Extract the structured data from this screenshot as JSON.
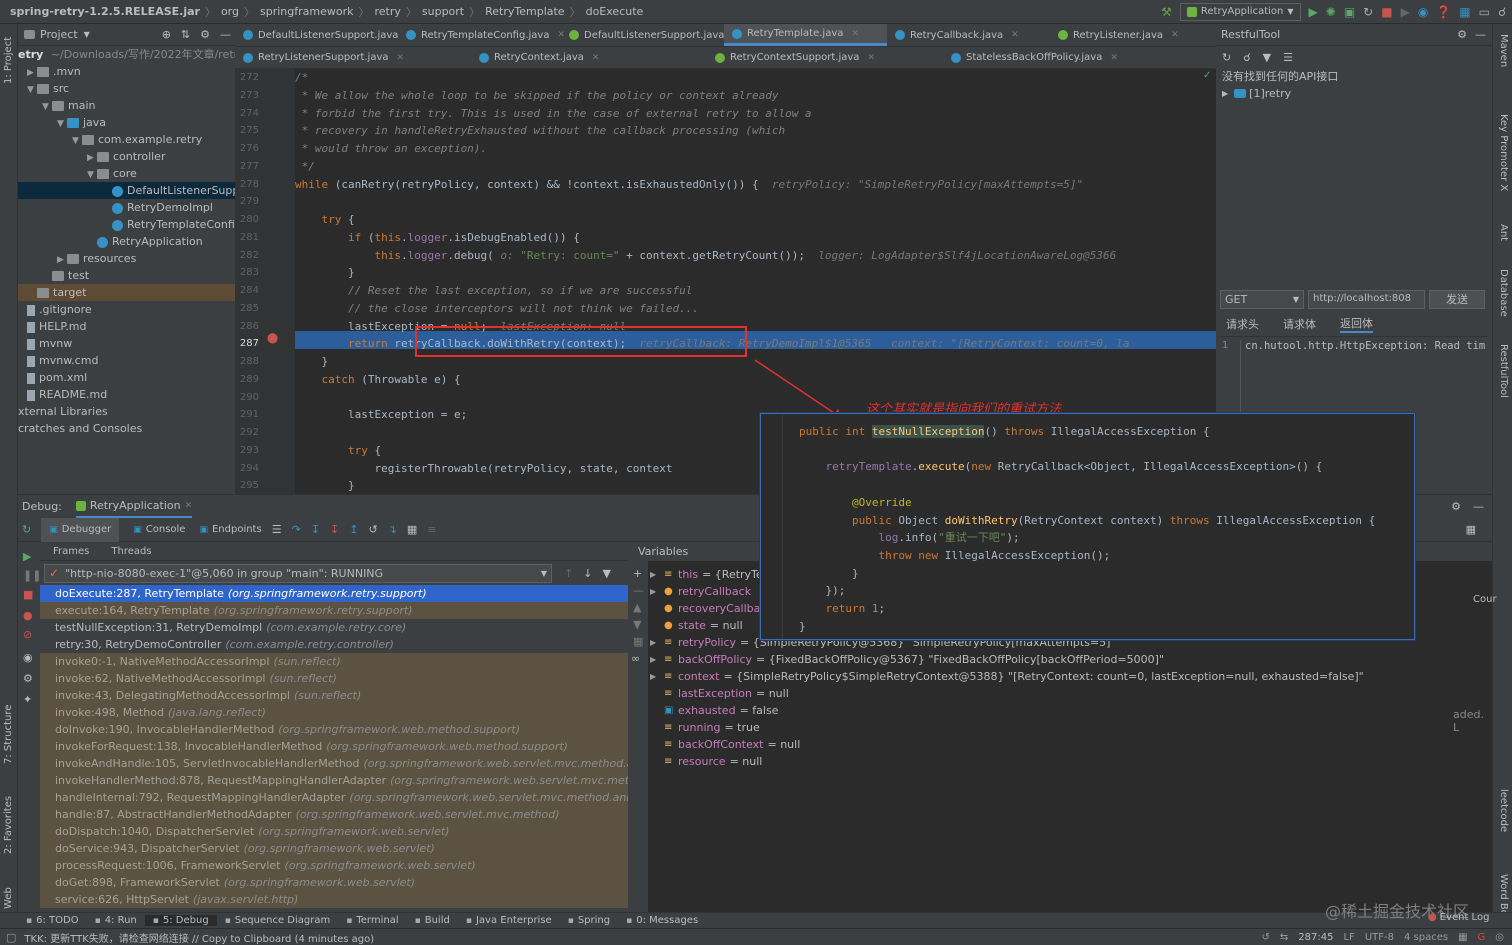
{
  "navbar": {
    "crumbs": [
      "spring-retry-1.2.5.RELEASE.jar",
      "org",
      "springframework",
      "retry",
      "support",
      "RetryTemplate",
      "doExecute"
    ],
    "run_config": "RetryApplication"
  },
  "editor_tabs_row1": [
    "DefaultListenerSupport.java",
    "RetryTemplateConfig.java",
    "DefaultListenerSupport.java",
    "RetryTemplate.java",
    "RetryCallback.java",
    "RetryListener.java"
  ],
  "editor_tabs_row2": [
    "RetryListenerSupport.java",
    "RetryContext.java",
    "RetryContextSupport.java",
    "StatelessBackOffPolicy.java"
  ],
  "active_tab": "RetryTemplate.java",
  "project": {
    "header": "Project",
    "root": "etry",
    "root_path": "~/Downloads/写作/2022年文章/retry",
    "items": [
      {
        "label": ".mvn",
        "kind": "folder",
        "indent": 1,
        "open": false
      },
      {
        "label": "src",
        "kind": "folder",
        "indent": 1,
        "open": true
      },
      {
        "label": "main",
        "kind": "folder",
        "indent": 2,
        "open": true
      },
      {
        "label": "java",
        "kind": "folder",
        "indent": 3,
        "open": true
      },
      {
        "label": "com.example.retry",
        "kind": "folder",
        "indent": 4,
        "open": true
      },
      {
        "label": "controller",
        "kind": "folder",
        "indent": 5,
        "open": false
      },
      {
        "label": "core",
        "kind": "folder",
        "indent": 5,
        "open": true
      },
      {
        "label": "DefaultListenerSupport",
        "kind": "class",
        "indent": 6,
        "selected": true
      },
      {
        "label": "RetryDemoImpl",
        "kind": "class",
        "indent": 6
      },
      {
        "label": "RetryTemplateConfig",
        "kind": "class",
        "indent": 6
      },
      {
        "label": "RetryApplication",
        "kind": "class",
        "indent": 5
      },
      {
        "label": "resources",
        "kind": "folder",
        "indent": 3,
        "open": false
      },
      {
        "label": "test",
        "kind": "folder",
        "indent": 2
      },
      {
        "label": "target",
        "kind": "folder",
        "indent": 1,
        "excluded": true
      },
      {
        "label": ".gitignore",
        "kind": "file",
        "indent": 1
      },
      {
        "label": "HELP.md",
        "kind": "file",
        "indent": 1
      },
      {
        "label": "mvnw",
        "kind": "file",
        "indent": 1
      },
      {
        "label": "mvnw.cmd",
        "kind": "file",
        "indent": 1
      },
      {
        "label": "pom.xml",
        "kind": "file",
        "indent": 1
      },
      {
        "label": "README.md",
        "kind": "file",
        "indent": 1
      },
      {
        "label": "xternal Libraries",
        "kind": "lib",
        "indent": 0
      },
      {
        "label": "cratches and Consoles",
        "kind": "lib",
        "indent": 0
      }
    ]
  },
  "code_lines": [
    {
      "n": "272",
      "html": "<span class='cm'>/*</span>"
    },
    {
      "n": "273",
      "html": "<span class='cm'> * We allow the whole loop to be skipped if the policy or context already</span>"
    },
    {
      "n": "274",
      "html": "<span class='cm'> * forbid the first try. This is used in the case of external retry to allow a</span>"
    },
    {
      "n": "275",
      "html": "<span class='cm'> * recovery in handleRetryExhausted without the callback processing (which</span>"
    },
    {
      "n": "276",
      "html": "<span class='cm'> * would throw an exception).</span>"
    },
    {
      "n": "277",
      "html": "<span class='cm'> */</span>"
    },
    {
      "n": "278",
      "html": "<span class='kw'>while</span> (canRetry(retryPolicy, context) &amp;&amp; !context.isExhaustedOnly()) {  <span class='hint'>retryPolicy: \"SimpleRetryPolicy[maxAttempts=5]\"</span>"
    },
    {
      "n": "279",
      "html": ""
    },
    {
      "n": "280",
      "html": "    <span class='kw'>try</span> {"
    },
    {
      "n": "281",
      "html": "        <span class='kw'>if</span> (<span class='kw'>this</span>.<span class='fld'>logger</span>.isDebugEnabled()) {"
    },
    {
      "n": "282",
      "html": "            <span class='kw'>this</span>.<span class='fld'>logger</span>.debug( <span class='hint'>o:</span> <span class='st'>\"Retry: count=\"</span> + context.getRetryCount());  <span class='hint'>logger: LogAdapter$Slf4jLocationAwareLog@5366</span>"
    },
    {
      "n": "283",
      "html": "        }"
    },
    {
      "n": "284",
      "html": "        <span class='cm'>// Reset the last exception, so if we are successful</span>"
    },
    {
      "n": "285",
      "html": "        <span class='cm'>// the close interceptors will not think we failed...</span>"
    },
    {
      "n": "286",
      "html": "        lastException = <span class='kw'>null</span>;  <span class='hint'>lastException: null</span>"
    },
    {
      "n": "287",
      "html": "        <span class='kw'>return</span> retryCallback.doWithRetry(context);  <span class='hint'>retryCallback: RetryDemoImpl$1@5365   context: \"[RetryContext: count=0, la</span>"
    },
    {
      "n": "288",
      "html": "    }"
    },
    {
      "n": "289",
      "html": "    <span class='kw'>catch</span> (Throwable e) {"
    },
    {
      "n": "290",
      "html": ""
    },
    {
      "n": "291",
      "html": "        lastException = e;"
    },
    {
      "n": "292",
      "html": ""
    },
    {
      "n": "293",
      "html": "        <span class='kw'>try</span> {"
    },
    {
      "n": "294",
      "html": "            registerThrowable(retryPolicy, state, context"
    },
    {
      "n": "295",
      "html": "        }"
    }
  ],
  "annotation": {
    "text": "这个其实就是指向我们的重试方法"
  },
  "popup_lines": [
    "<span class='kw'>public int</span> <span style='background:#3b514d;color:#ffc66d'>testNullException</span>() <span class='kw'>throws</span> IllegalAccessException {",
    "",
    "    <span class='fld'>retryTemplate</span>.<span style='color:#ffc66d'>execute</span>(<span class='kw'>new</span> RetryCallback&lt;Object, IllegalAccessException&gt;() {",
    "",
    "        <span style='color:#bbb529'>@Override</span>",
    "        <span class='kw'>public</span> Object <span style='color:#ffc66d'>doWithRetry</span>(RetryContext context) <span class='kw'>throws</span> IllegalAccessException {",
    "            <span class='fld'>log</span>.info(<span class='st'>\"重试一下吧\"</span>);",
    "            <span class='kw'>throw new</span> IllegalAccessException();",
    "        }",
    "    });",
    "    <span class='kw'>return</span> <span style='color:#6897bb'>1</span>;",
    "}"
  ],
  "restful": {
    "title": "RestfulTool",
    "empty_msg": "没有找到任何的API接口",
    "tree_item": "[1]retry",
    "method": "GET",
    "url": "http://localhost:808",
    "send": "发送",
    "tabs": [
      "请求头",
      "请求体",
      "返回体"
    ],
    "response_line_no": "1",
    "response": "cn.hutool.http.HttpException: Read tim"
  },
  "debug": {
    "label": "Debug:",
    "session": "RetryApplication",
    "tabs": [
      "Debugger",
      "Console",
      "Endpoints"
    ],
    "subtabs": [
      "Frames",
      "Threads"
    ],
    "variables_title": "Variables",
    "thread": "\"http-nio-8080-exec-1\"@5,060 in group \"main\": RUNNING",
    "frames": [
      {
        "m": "doExecute:287, RetryTemplate",
        "p": "(org.springframework.retry.support)",
        "sel": true
      },
      {
        "m": "execute:164, RetryTemplate",
        "p": "(org.springframework.retry.support)",
        "dim": true
      },
      {
        "m": "testNullException:31, RetryDemoImpl",
        "p": "(com.example.retry.core)"
      },
      {
        "m": "retry:30, RetryDemoController",
        "p": "(com.example.retry.controller)"
      },
      {
        "m": "invoke0:-1, NativeMethodAccessorImpl",
        "p": "(sun.reflect)",
        "dim": true
      },
      {
        "m": "invoke:62, NativeMethodAccessorImpl",
        "p": "(sun.reflect)",
        "dim": true
      },
      {
        "m": "invoke:43, DelegatingMethodAccessorImpl",
        "p": "(sun.reflect)",
        "dim": true
      },
      {
        "m": "invoke:498, Method",
        "p": "(java.lang.reflect)",
        "dim": true
      },
      {
        "m": "doInvoke:190, InvocableHandlerMethod",
        "p": "(org.springframework.web.method.support)",
        "dim": true
      },
      {
        "m": "invokeForRequest:138, InvocableHandlerMethod",
        "p": "(org.springframework.web.method.support)",
        "dim": true
      },
      {
        "m": "invokeAndHandle:105, ServletInvocableHandlerMethod",
        "p": "(org.springframework.web.servlet.mvc.method.an",
        "dim": true
      },
      {
        "m": "invokeHandlerMethod:878, RequestMappingHandlerAdapter",
        "p": "(org.springframework.web.servlet.mvc.metho",
        "dim": true
      },
      {
        "m": "handleInternal:792, RequestMappingHandlerAdapter",
        "p": "(org.springframework.web.servlet.mvc.method.annot",
        "dim": true
      },
      {
        "m": "handle:87, AbstractHandlerMethodAdapter",
        "p": "(org.springframework.web.servlet.mvc.method)",
        "dim": true
      },
      {
        "m": "doDispatch:1040, DispatcherServlet",
        "p": "(org.springframework.web.servlet)",
        "dim": true
      },
      {
        "m": "doService:943, DispatcherServlet",
        "p": "(org.springframework.web.servlet)",
        "dim": true
      },
      {
        "m": "processRequest:1006, FrameworkServlet",
        "p": "(org.springframework.web.servlet)",
        "dim": true
      },
      {
        "m": "doGet:898, FrameworkServlet",
        "p": "(org.springframework.web.servlet)",
        "dim": true
      },
      {
        "m": "service:626, HttpServlet",
        "p": "(javax.servlet.http)",
        "dim": true
      }
    ],
    "variables": [
      {
        "name": "this",
        "val": "= {RetryTe",
        "icon": "list",
        "arrow": true
      },
      {
        "name": "retryCallback",
        "val": "",
        "icon": "p",
        "arrow": true
      },
      {
        "name": "recoveryCallba",
        "val": "",
        "icon": "p",
        "arrow": false
      },
      {
        "name": "state",
        "val": "= null",
        "icon": "p",
        "arrow": false
      },
      {
        "name": "retryPolicy",
        "val": "= {SimpleRetryPolicy@5368} \"SimpleRetryPolicy[maxAttempts=5]\"",
        "icon": "list",
        "arrow": true
      },
      {
        "name": "backOffPolicy",
        "val": "= {FixedBackOffPolicy@5367} \"FixedBackOffPolicy[backOffPeriod=5000]\"",
        "icon": "list",
        "arrow": true
      },
      {
        "name": "context",
        "val": "= {SimpleRetryPolicy$SimpleRetryContext@5388} \"[RetryContext: count=0, lastException=null, exhausted=false]\"",
        "icon": "list",
        "arrow": true
      },
      {
        "name": "lastException",
        "val": "= null",
        "icon": "list",
        "arrow": false
      },
      {
        "name": "exhausted",
        "val": "= false",
        "icon": "bool",
        "arrow": false
      },
      {
        "name": "running",
        "val": "= true",
        "icon": "list",
        "arrow": false
      },
      {
        "name": "backOffContext",
        "val": "= null",
        "icon": "list",
        "arrow": false
      },
      {
        "name": "resource",
        "val": "= null",
        "icon": "list",
        "arrow": false
      }
    ],
    "right_cut": [
      "Cour",
      "aded. L"
    ]
  },
  "toolwindows": [
    "6: TODO",
    "4: Run",
    "5: Debug",
    "Sequence Diagram",
    "Terminal",
    "Build",
    "Java Enterprise",
    "Spring",
    "0: Messages"
  ],
  "status": {
    "message": "TKK: 更新TTK失败，请检查网络连接 // Copy to Clipboard (4 minutes ago)",
    "position": "287:45",
    "lf": "LF",
    "enc": "UTF-8",
    "indent": "4 spaces",
    "event_log": "Event Log",
    "watermark": "@稀土掘金技术社区"
  },
  "side_labels": {
    "left": [
      "1: Project",
      "7: Structure",
      "2: Favorites",
      "Web"
    ],
    "right": [
      "Maven",
      "Key Promoter X",
      "Ant",
      "Database",
      "RestfulTool",
      "leetcode",
      "Word Book"
    ]
  },
  "colors": {
    "selection": "#2d5e9c",
    "accent": "#4a88c7",
    "annotation": "#e0312e"
  }
}
